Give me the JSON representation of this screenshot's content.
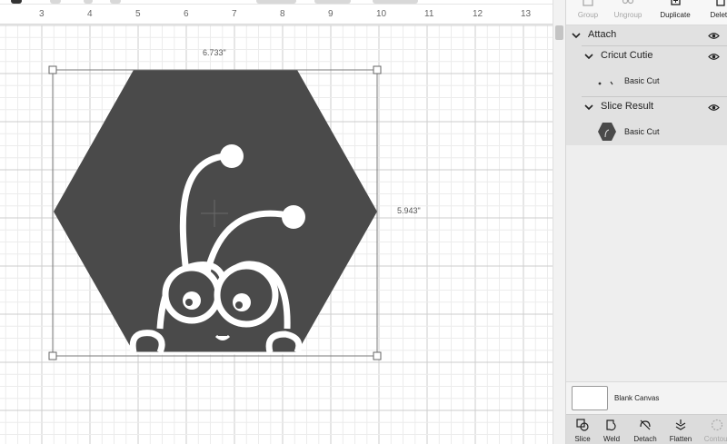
{
  "ruler": {
    "labels": [
      "3",
      "4",
      "5",
      "6",
      "7",
      "8",
      "9",
      "10",
      "11",
      "12",
      "13"
    ]
  },
  "selection": {
    "width_label": "6.733\"",
    "height_label": "5.943\""
  },
  "toolbar_top": {
    "group": "Group",
    "ungroup": "Ungroup",
    "duplicate": "Duplicate",
    "delete": "Delete"
  },
  "layers": {
    "attach": "Attach",
    "cricut_cutie": "Cricut Cutie",
    "basic_cut_1": "Basic Cut",
    "slice_result": "Slice Result",
    "basic_cut_2": "Basic Cut"
  },
  "canvas_setting": {
    "label": "Blank Canvas"
  },
  "toolbar_bottom": {
    "slice": "Slice",
    "weld": "Weld",
    "detach": "Detach",
    "flatten": "Flatten",
    "contour": "Contour"
  },
  "colors": {
    "shape_fill": "#4a4a4a",
    "accent": "#222222"
  }
}
